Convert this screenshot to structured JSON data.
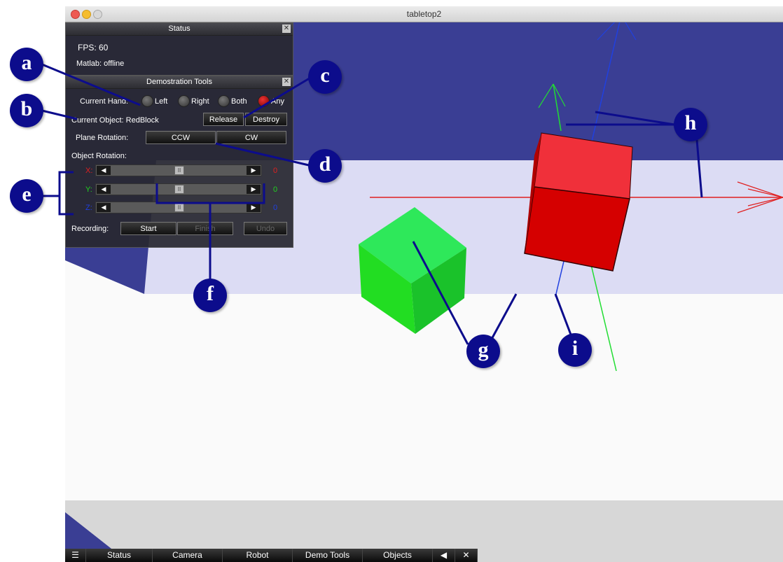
{
  "window": {
    "title": "tabletop2"
  },
  "status_panel": {
    "title": "Status",
    "fps": "FPS: 60",
    "matlab": "Matlab: offline"
  },
  "demo_panel": {
    "title": "Demostration Tools",
    "current_hand_label": "Current Hand:",
    "hand_options": [
      "Left",
      "Right",
      "Both",
      "Any"
    ],
    "hand_selected": "Any",
    "current_object_label": "Current Object: RedBlock",
    "release_label": "Release",
    "destroy_label": "Destroy",
    "plane_rotation_label": "Plane Rotation:",
    "ccw_label": "CCW",
    "cw_label": "CW",
    "object_rotation_label": "Object Rotation:",
    "sliders": [
      {
        "axis": "X:",
        "value": "0",
        "color": "#e02020"
      },
      {
        "axis": "Y:",
        "value": "0",
        "color": "#20d020"
      },
      {
        "axis": "Z:",
        "value": "0",
        "color": "#2040e0"
      }
    ],
    "recording_label": "Recording:",
    "start_label": "Start",
    "finish_label": "Finish",
    "undo_label": "Undo"
  },
  "taskbar": {
    "tabs": [
      "Status",
      "Camera",
      "Robot",
      "Demo Tools",
      "Objects"
    ]
  },
  "callouts": [
    "a",
    "b",
    "c",
    "d",
    "e",
    "f",
    "g",
    "h",
    "i"
  ],
  "colors": {
    "callout": "#0c0c8c",
    "red_block": "#dd0000",
    "green_block": "#22dd33",
    "viewport_bg": "#3a3e94"
  }
}
